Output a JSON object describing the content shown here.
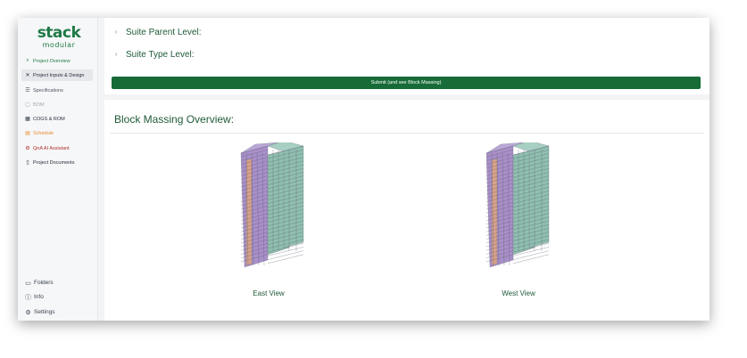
{
  "logo": {
    "main": "stack",
    "sub": "modular"
  },
  "sidebar": {
    "items": [
      {
        "label": "Project Overview",
        "icon": "search-icon"
      },
      {
        "label": "Project Inputs & Design",
        "icon": "tools-icon"
      },
      {
        "label": "Specifications",
        "icon": "list-icon"
      },
      {
        "label": "BOM",
        "icon": "doc-icon"
      },
      {
        "label": "COGS & ROM",
        "icon": "calculator-icon"
      },
      {
        "label": "Schedule",
        "icon": "calendar-icon"
      },
      {
        "label": "QnA AI Assistant",
        "icon": "ai-icon"
      },
      {
        "label": "Project Documents",
        "icon": "file-icon"
      }
    ],
    "bottom": [
      {
        "label": "Folders",
        "icon": "folder-icon"
      },
      {
        "label": "Info",
        "icon": "info-icon"
      },
      {
        "label": "Settings",
        "icon": "gear-icon"
      }
    ]
  },
  "main": {
    "suite_parent_label": "Suite Parent Level:",
    "suite_type_label": "Suite Type Level:",
    "submit_label": "Submit (and see Block Massing)",
    "section_title": "Block Massing Overview:",
    "views": [
      {
        "label": "East View"
      },
      {
        "label": "West View"
      }
    ]
  },
  "colors": {
    "brand": "#1f7a46",
    "submit": "#166b37",
    "schedule": "#e88a2e",
    "qna": "#b0302a",
    "massing_purple": "#a98fc8",
    "massing_teal": "#8fbfb0",
    "massing_salmon": "#d9a28a"
  }
}
